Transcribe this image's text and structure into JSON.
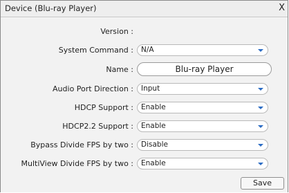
{
  "window": {
    "title": "Device (Blu-ray Player)",
    "close_label": "X"
  },
  "fields": {
    "version": {
      "label": "Version :"
    },
    "system_command": {
      "label": "System Command :",
      "value": "N/A"
    },
    "name": {
      "label": "Name :",
      "value": "Blu-ray Player"
    },
    "audio_port_direction": {
      "label": "Audio Port Direction :",
      "value": "Input"
    },
    "hdcp_support": {
      "label": "HDCP Support :",
      "value": "Enable"
    },
    "hdcp22_support": {
      "label": "HDCP2.2 Support :",
      "value": "Enable"
    },
    "bypass_divide_fps": {
      "label": "Bypass Divide FPS by two :",
      "value": "Disable"
    },
    "multiview_divide_fps": {
      "label": "MultiView Divide FPS by two :",
      "value": "Enable"
    }
  },
  "buttons": {
    "save_label": "Save"
  },
  "colors": {
    "dropdown_arrow": "#2b6cc4",
    "content_background": "#f2f2f2",
    "titlebar_background": "#eeeeee"
  },
  "icons": {
    "dropdown": "chevron-down-icon",
    "close": "close-icon"
  }
}
